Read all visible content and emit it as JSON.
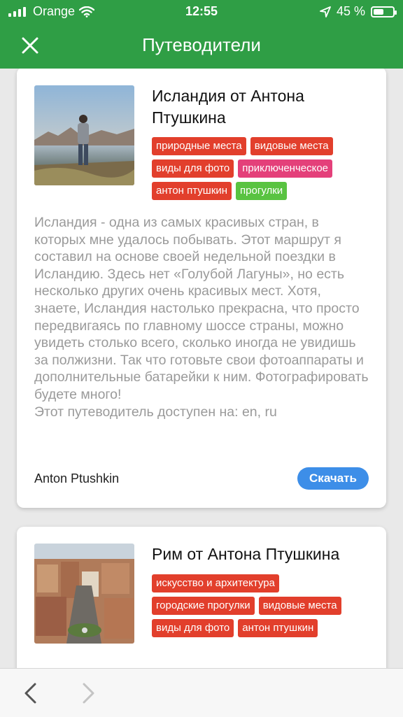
{
  "status": {
    "carrier": "Orange",
    "time": "12:55",
    "battery": "45 %",
    "battery_level": 0.45
  },
  "header": {
    "title": "Путеводители"
  },
  "guides": [
    {
      "title": "Исландия от Антона Птушкина",
      "tags": [
        {
          "label": "природные места",
          "color": "#e23f2c"
        },
        {
          "label": "видовые места",
          "color": "#e23f2c"
        },
        {
          "label": "виды для фото",
          "color": "#e23f2c"
        },
        {
          "label": "приключенческое",
          "color": "#e4407a"
        },
        {
          "label": "антон птушкин",
          "color": "#e23f2c"
        },
        {
          "label": "прогулки",
          "color": "#59c341"
        }
      ],
      "description": "Исландия - одна из самых красивых стран, в которых мне удалось побывать. Этот маршрут я составил на основе своей недельной поездки в Исландию. Здесь нет «Голубой Лагуны», но есть несколько других очень красивых мест. Хотя, знаете, Исландия настолько прекрасна, что просто передвигаясь по главному шоссе страны, можно увидеть столько всего, сколько иногда не увидишь за полжизни. Так что готовьте свои фотоаппараты и дополнительные батарейки к ним. Фотографировать будете много!",
      "languages": "Этот путеводитель доступен на: en, ru",
      "author": "Anton Ptushkin",
      "download_label": "Скачать"
    },
    {
      "title": "Рим от Антона Птушкина",
      "tags": [
        {
          "label": "искусство и архитектура",
          "color": "#e23f2c"
        },
        {
          "label": "городские прогулки",
          "color": "#e23f2c"
        },
        {
          "label": "видовые места",
          "color": "#e23f2c"
        },
        {
          "label": "виды для фото",
          "color": "#e23f2c"
        },
        {
          "label": "антон птушкин",
          "color": "#e23f2c"
        }
      ]
    }
  ],
  "colors": {
    "header_green": "#2f9e45",
    "tag_red": "#e23f2c",
    "tag_pink": "#e4407a",
    "tag_green": "#59c341",
    "download_blue": "#3d8ee8"
  },
  "icons": {
    "close": "close-icon",
    "back": "chevron-left-icon",
    "forward": "chevron-right-icon",
    "wifi": "wifi-icon",
    "location": "location-arrow-icon",
    "battery": "battery-icon"
  }
}
